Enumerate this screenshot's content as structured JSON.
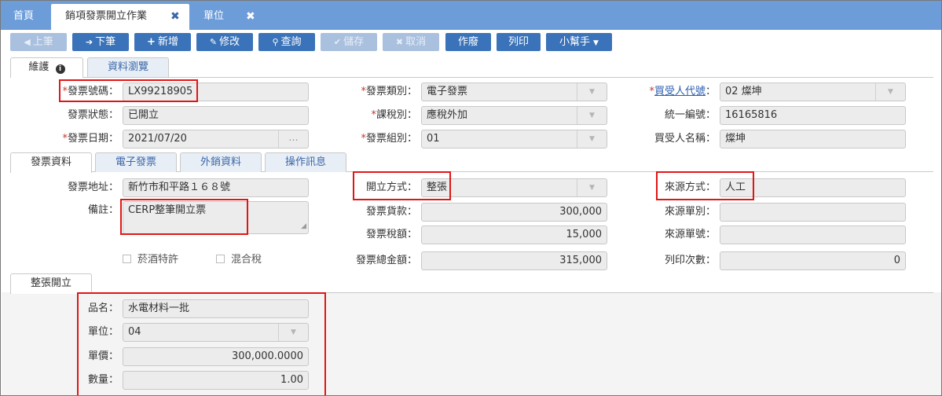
{
  "top_tabs": [
    {
      "label": "首頁"
    },
    {
      "label": "銷項發票開立作業",
      "close": "✖"
    },
    {
      "label": "單位",
      "close": "✖"
    }
  ],
  "toolbar": {
    "prev": "上筆",
    "next": "下筆",
    "add": "新增",
    "edit": "修改",
    "query": "查詢",
    "save": "儲存",
    "cancel": "取消",
    "void": "作廢",
    "print": "列印",
    "helper": "小幫手"
  },
  "main_tabs": {
    "maintain": "維護",
    "browse": "資料瀏覽"
  },
  "header": {
    "invoice_no_label": "發票號碼：",
    "invoice_no": "LX99218905",
    "invoice_status_label": "發票狀態：",
    "invoice_status": "已開立",
    "invoice_date_label": "發票日期：",
    "invoice_date": "2021/07/20",
    "date_btn": "...",
    "invoice_type_label": "發票類別：",
    "invoice_type": "電子發票",
    "tax_type_label": "課稅別：",
    "tax_type": "應稅外加",
    "invoice_group_label": "發票組別：",
    "invoice_group": "01",
    "buyer_code_label": "買受人代號",
    "buyer_code_colon": "：",
    "buyer_code": "02 燦坤",
    "tax_id_label": "統一編號：",
    "tax_id": "16165816",
    "buyer_name_label": "買受人名稱：",
    "buyer_name": "燦坤"
  },
  "detail_tabs": {
    "invoice_data": "發票資料",
    "e_invoice": "電子發票",
    "export_data": "外銷資料",
    "op_log": "操作訊息"
  },
  "detail": {
    "address_label": "發票地址：",
    "address": "新竹市和平路１６８號",
    "note_label": "備註：",
    "note": "CERP整筆開立票",
    "tobacco": "菸酒特許",
    "mixed_tax": "混合稅",
    "issue_method_label": "開立方式：",
    "issue_method": "整張",
    "goods_amount_label": "發票貨款：",
    "goods_amount": "300,000",
    "tax_amount_label": "發票稅額：",
    "tax_amount": "15,000",
    "total_amount_label": "發票總金額：",
    "total_amount": "315,000",
    "source_method_label": "來源方式：",
    "source_method": "人工",
    "source_type_label": "來源單別：",
    "source_type": "",
    "source_no_label": "來源單號：",
    "source_no": "",
    "print_count_label": "列印次數：",
    "print_count": "0"
  },
  "whole_tab": {
    "label": "整張開立",
    "item_name_label": "品名：",
    "item_name": "水電材料一批",
    "unit_label": "單位：",
    "unit": "04",
    "price_label": "單價：",
    "price": "300,000.0000",
    "qty_label": "數量：",
    "qty": "1.00"
  },
  "colors": {
    "top_bar": "#6d9dd9",
    "button": "#3a73b9",
    "button_disabled": "#a9c0de",
    "highlight_box": "#e01616"
  }
}
